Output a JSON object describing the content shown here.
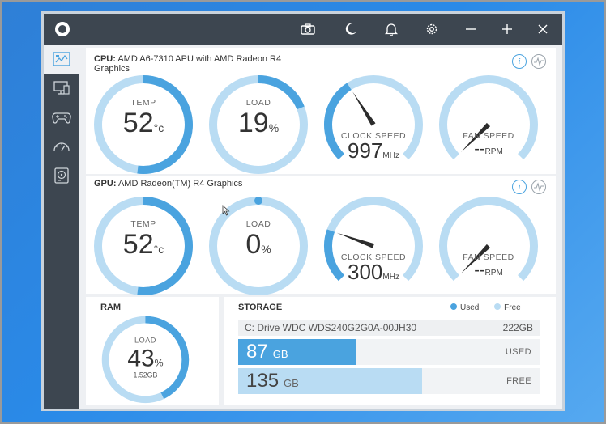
{
  "titlebar": {
    "icons": [
      "camera-icon",
      "moon-icon",
      "bell-icon",
      "gear-icon",
      "minimize-icon",
      "maximize-icon",
      "close-icon"
    ]
  },
  "cpu": {
    "title_bold": "CPU:",
    "title": "AMD A6-7310 APU with AMD Radeon R4 Graphics",
    "temp": {
      "label": "TEMP",
      "value": "52",
      "unit": "°c",
      "level": 0.52
    },
    "load": {
      "label": "LOAD",
      "value": "19",
      "unit": "%",
      "level": 0.19
    },
    "clock": {
      "label": "CLOCK SPEED",
      "value": "997",
      "unit": "MHz",
      "level": 0.38
    },
    "fan": {
      "label": "FAN SPEED",
      "value": "--",
      "unit": "RPM",
      "level": 0.0
    }
  },
  "gpu": {
    "title_bold": "GPU:",
    "title": "AMD Radeon(TM) R4 Graphics",
    "temp": {
      "label": "TEMP",
      "value": "52",
      "unit": "°c",
      "level": 0.52
    },
    "load": {
      "label": "LOAD",
      "value": "0",
      "unit": "%",
      "level": 0.0
    },
    "clock": {
      "label": "CLOCK SPEED",
      "value": "300",
      "unit": "MHz",
      "level": 0.24
    },
    "fan": {
      "label": "FAN SPEED",
      "value": "--",
      "unit": "RPM",
      "level": 0.0
    }
  },
  "ram": {
    "title": "RAM",
    "label": "LOAD",
    "value": "43",
    "unit": "%",
    "sub": "1.52GB",
    "level": 0.43
  },
  "storage": {
    "title": "STORAGE",
    "legend_used": "Used",
    "legend_free": "Free",
    "drive": "C: Drive WDC WDS240G2G0A-00JH30",
    "capacity": "222GB",
    "used_value": "87",
    "used_unit": "GB",
    "used_label": "USED",
    "used_fraction": 0.39,
    "free_value": "135",
    "free_unit": "GB",
    "free_label": "FREE",
    "free_fraction": 0.61
  },
  "colors": {
    "accent": "#4aa3df",
    "light": "#b9dcf3",
    "dark": "#3d4650"
  }
}
